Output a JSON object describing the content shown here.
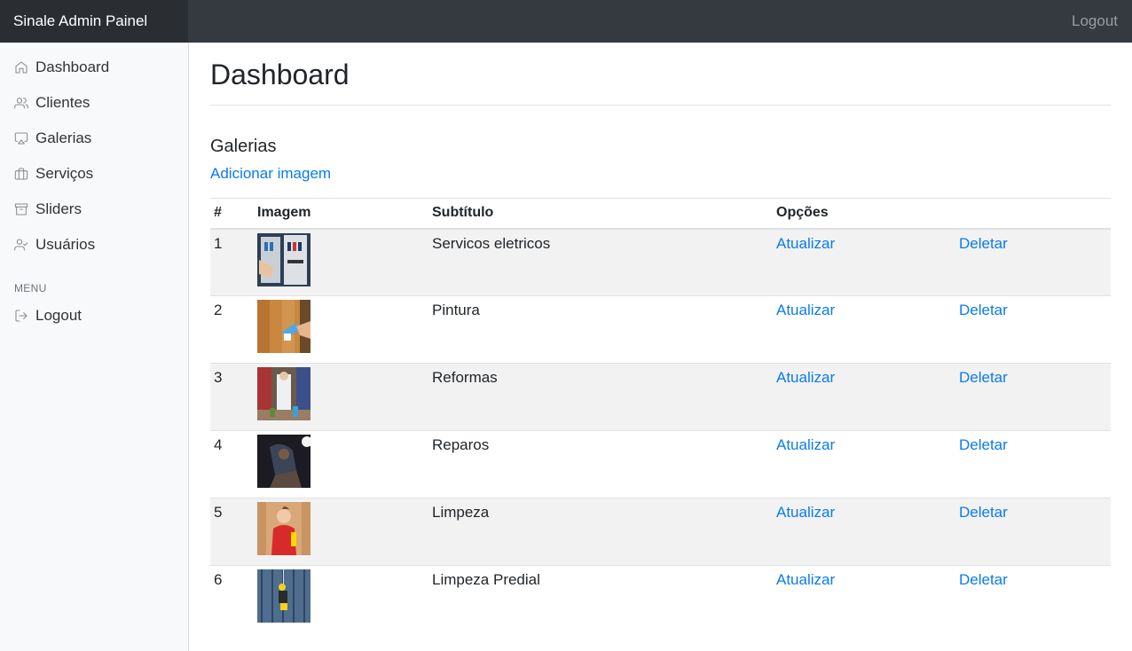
{
  "header": {
    "brand": "Sinale Admin Painel",
    "logout": "Logout"
  },
  "sidebar": {
    "items": [
      {
        "label": "Dashboard",
        "icon": "home-icon"
      },
      {
        "label": "Clientes",
        "icon": "users-icon"
      },
      {
        "label": "Galerias",
        "icon": "airplay-icon"
      },
      {
        "label": "Serviços",
        "icon": "briefcase-icon"
      },
      {
        "label": "Sliders",
        "icon": "archive-icon"
      },
      {
        "label": "Usuários",
        "icon": "user-check-icon"
      }
    ],
    "menu_heading": "MENU",
    "logout": {
      "label": "Logout",
      "icon": "log-out-icon"
    }
  },
  "main": {
    "title": "Dashboard",
    "section_title": "Galerias",
    "add_link": "Adicionar imagem",
    "table": {
      "headers": [
        "#",
        "Imagem",
        "Subtítulo",
        "Opções",
        ""
      ],
      "rows": [
        {
          "num": "1",
          "subtitle": "Servicos eletricos",
          "update": "Atualizar",
          "delete": "Deletar",
          "image": "electrical-panel"
        },
        {
          "num": "2",
          "subtitle": "Pintura",
          "update": "Atualizar",
          "delete": "Deletar",
          "image": "painting-wood"
        },
        {
          "num": "3",
          "subtitle": "Reformas",
          "update": "Atualizar",
          "delete": "Deletar",
          "image": "renovation-worker"
        },
        {
          "num": "4",
          "subtitle": "Reparos",
          "update": "Atualizar",
          "delete": "Deletar",
          "image": "repair-dark"
        },
        {
          "num": "5",
          "subtitle": "Limpeza",
          "update": "Atualizar",
          "delete": "Deletar",
          "image": "cleaning-red"
        },
        {
          "num": "6",
          "subtitle": "Limpeza Predial",
          "update": "Atualizar",
          "delete": "Deletar",
          "image": "building-cleaning"
        }
      ]
    }
  },
  "colors": {
    "topbar": "#343a40",
    "brand_bg": "#2a2e33",
    "sidebar_bg": "#f8f9fa",
    "link": "#0a7bf0",
    "stripe": "#f2f2f2"
  }
}
